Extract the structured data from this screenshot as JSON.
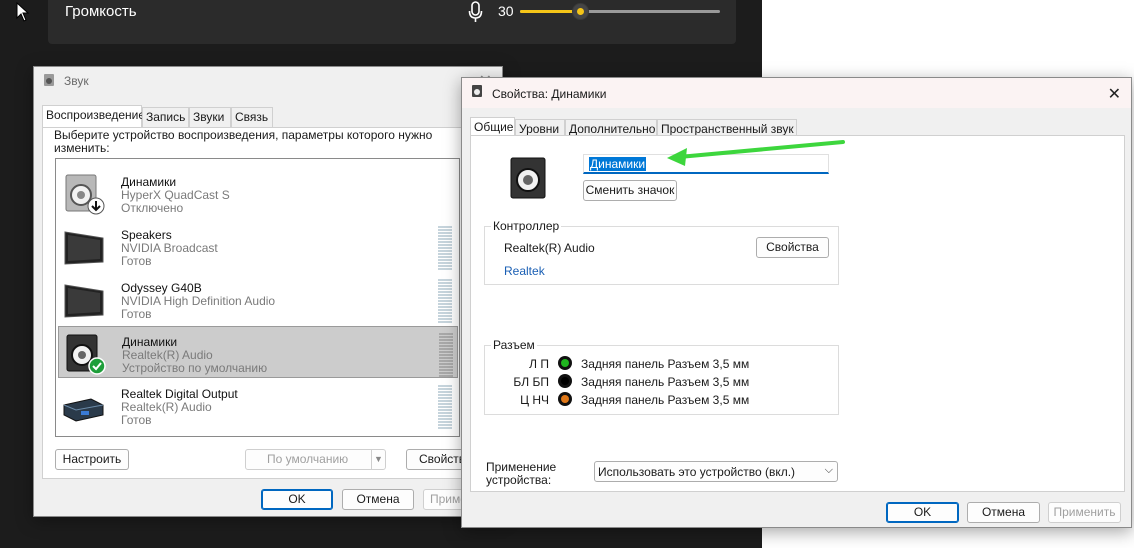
{
  "volume_flyout": {
    "label": "Громкость",
    "value": "30",
    "level": 0.3,
    "accent_color": "#f5c518",
    "mic_icon": "microphone-icon"
  },
  "sound_window": {
    "title": "Звук",
    "tabs": [
      "Воспроизведение",
      "Запись",
      "Звуки",
      "Связь"
    ],
    "instruction": "Выберите устройство воспроизведения, параметры которого нужно изменить:",
    "devices": [
      {
        "name": "Динамики",
        "sub": "HyperX QuadCast S",
        "status": "Отключено",
        "icon": "speaker-icon",
        "badge": "disabled-arrow-badge"
      },
      {
        "name": "Speakers",
        "sub": "NVIDIA Broadcast",
        "status": "Готов",
        "icon": "monitor-icon"
      },
      {
        "name": "Odyssey G40B",
        "sub": "NVIDIA High Definition Audio",
        "status": "Готов",
        "icon": "monitor-icon"
      },
      {
        "name": "Динамики",
        "sub": "Realtek(R) Audio",
        "status": "Устройство по умолчанию",
        "icon": "speaker-icon",
        "badge": "default-check-badge"
      },
      {
        "name": "Realtek Digital Output",
        "sub": "Realtek(R) Audio",
        "status": "Готов",
        "icon": "digital-output-icon"
      }
    ],
    "configure_label": "Настроить",
    "default_label": "По умолчанию",
    "properties_label": "Свойства",
    "ok_label": "OK",
    "cancel_label": "Отмена",
    "apply_label": "Применить"
  },
  "props_window": {
    "title": "Свойства: Динамики",
    "tabs": [
      "Общие",
      "Уровни",
      "Дополнительно",
      "Пространственный звук"
    ],
    "device_name_value": "Динамики",
    "change_icon_label": "Сменить значок",
    "controller": {
      "title": "Контроллер",
      "name": "Realtek(R) Audio",
      "properties_label": "Свойства",
      "vendor_link": "Realtek"
    },
    "jack": {
      "title": "Разъем",
      "rows": [
        {
          "code": "Л П",
          "text": "Задняя панель Разъем 3,5 мм",
          "color": "#1fb71f"
        },
        {
          "code": "БЛ БП",
          "text": "Задняя панель Разъем 3,5 мм",
          "color": "#000000"
        },
        {
          "code": "Ц НЧ",
          "text": "Задняя панель Разъем 3,5 мм",
          "color": "#e07818"
        }
      ]
    },
    "usage_label": "Применение устройства:",
    "usage_value": "Использовать это устройство (вкл.)",
    "ok_label": "OK",
    "cancel_label": "Отмена",
    "apply_label": "Применить",
    "arrow_color": "#3dd63d"
  }
}
